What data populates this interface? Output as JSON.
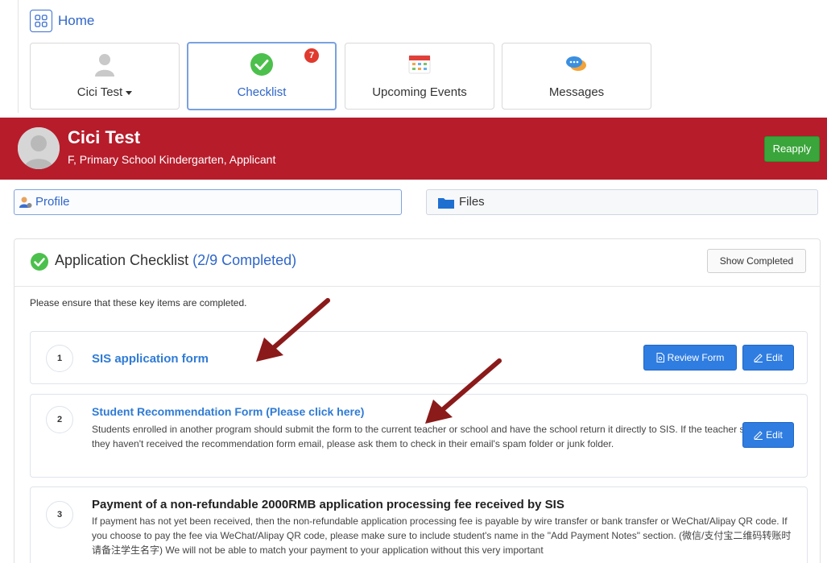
{
  "nav": {
    "home_label": "Home",
    "tiles": [
      {
        "label": "Cici Test",
        "icon": "user-icon"
      },
      {
        "label": "Checklist",
        "icon": "check-circle-icon",
        "badge": "7"
      },
      {
        "label": "Upcoming Events",
        "icon": "calendar-icon"
      },
      {
        "label": "Messages",
        "icon": "chat-bubbles-icon"
      }
    ]
  },
  "banner": {
    "name": "Cici Test",
    "subtitle": "F, Primary School Kindergarten, Applicant",
    "reapply_label": "Reapply",
    "color": "#b71c2b"
  },
  "tabs": {
    "profile_label": "Profile",
    "files_label": "Files"
  },
  "checklist": {
    "title": "Application Checklist",
    "count": "(2/9 Completed)",
    "show_completed_label": "Show Completed",
    "instruction": "Please ensure that these key items are completed.",
    "items": [
      {
        "number": "1",
        "title": "SIS application form",
        "review_label": "Review Form",
        "edit_label": "Edit"
      },
      {
        "number": "2",
        "title": "Student Recommendation Form (Please click here)",
        "description": "Students enrolled in another program should submit the form to the current teacher or school and have the school return it directly to SIS. If the teacher says they haven't received the recommendation form email, please ask them to check in their email's spam folder or junk folder.",
        "edit_label": "Edit"
      },
      {
        "number": "3",
        "title": "Payment of a non-refundable 2000RMB application processing fee received by SIS",
        "description": "If payment has not yet been received, then the non-refundable application processing fee is payable by wire transfer or bank transfer or WeChat/Alipay QR code. If you choose to pay the fee via WeChat/Alipay QR code, please make sure to include student's name in the \"Add Payment Notes\" section. (微信/支付宝二维码转账时请备注学生名字) We will not be able to match your payment to your application without this very important"
      }
    ]
  },
  "colors": {
    "accent_blue": "#2f7de1",
    "link_blue": "#2f7bd6",
    "reapply_green": "#3aa53a",
    "arrow_red": "#8b1a1a"
  }
}
